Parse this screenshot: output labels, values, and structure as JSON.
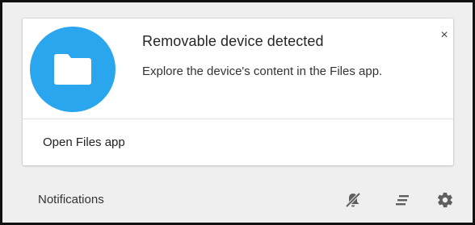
{
  "notification": {
    "title": "Removable device detected",
    "message": "Explore the device's content in the Files app.",
    "close_glyph": "×",
    "action_label": "Open Files app",
    "icon": "folder-icon",
    "icon_bg_color": "#29a6ee"
  },
  "footer": {
    "label": "Notifications",
    "buttons": [
      {
        "name": "do-not-disturb",
        "icon": "bell-off-icon"
      },
      {
        "name": "clear-all",
        "icon": "clear-all-icon"
      },
      {
        "name": "settings",
        "icon": "gear-icon"
      }
    ]
  }
}
